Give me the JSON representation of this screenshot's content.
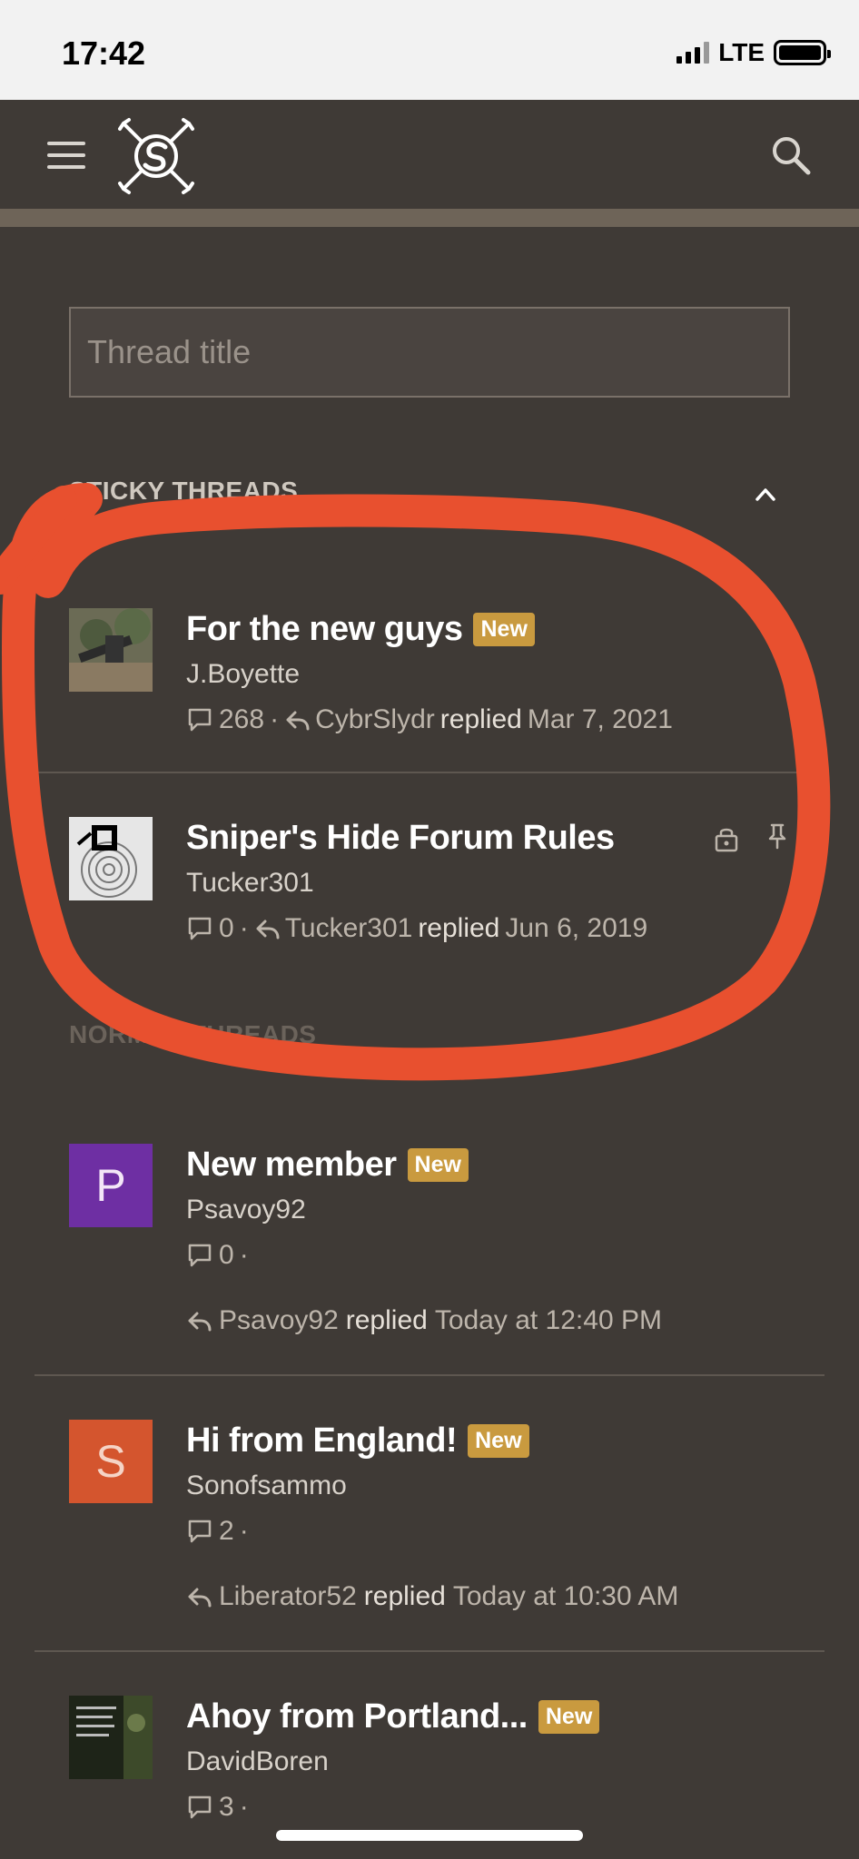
{
  "status_bar": {
    "time": "17:42",
    "network": "LTE"
  },
  "nav": {
    "menu_icon": "hamburger-icon",
    "logo_icon": "snipershide-logo",
    "search_icon": "search-icon"
  },
  "search": {
    "placeholder": "Thread title"
  },
  "sections": {
    "sticky": "STICKY THREADS",
    "normal": "NORMAL THREADS"
  },
  "sticky_threads": [
    {
      "title": "For the new guys",
      "badge": "New",
      "author": "J.Boyette",
      "replies": "268",
      "last_replier": "CybrSlydr",
      "replied_word": "replied",
      "date": "Mar 7, 2021",
      "pinned": true,
      "locked": false
    },
    {
      "title": "Sniper's Hide Forum Rules",
      "badge": "",
      "author": "Tucker301",
      "replies": "0",
      "last_replier": "Tucker301",
      "replied_word": "replied",
      "date": "Jun 6, 2019",
      "pinned": true,
      "locked": true
    }
  ],
  "normal_threads": [
    {
      "title": "New member",
      "badge": "New",
      "author": "Psavoy92",
      "avatar_letter": "P",
      "avatar_color": "#6e2fa3",
      "replies": "0",
      "last_replier": "Psavoy92",
      "replied_word": "replied",
      "date": "Today at 12:40 PM"
    },
    {
      "title": "Hi from England!",
      "badge": "New",
      "author": "Sonofsammo",
      "avatar_letter": "S",
      "avatar_color": "#d4552e",
      "replies": "2",
      "last_replier": "Liberator52",
      "replied_word": "replied",
      "date": "Today at 10:30 AM"
    },
    {
      "title": "Ahoy from Portland...",
      "badge": "New",
      "author": "DavidBoren",
      "replies": "3"
    }
  ],
  "colors": {
    "badge": "#c99a3f",
    "background": "#3f3a36",
    "annotation": "#e8502f"
  }
}
